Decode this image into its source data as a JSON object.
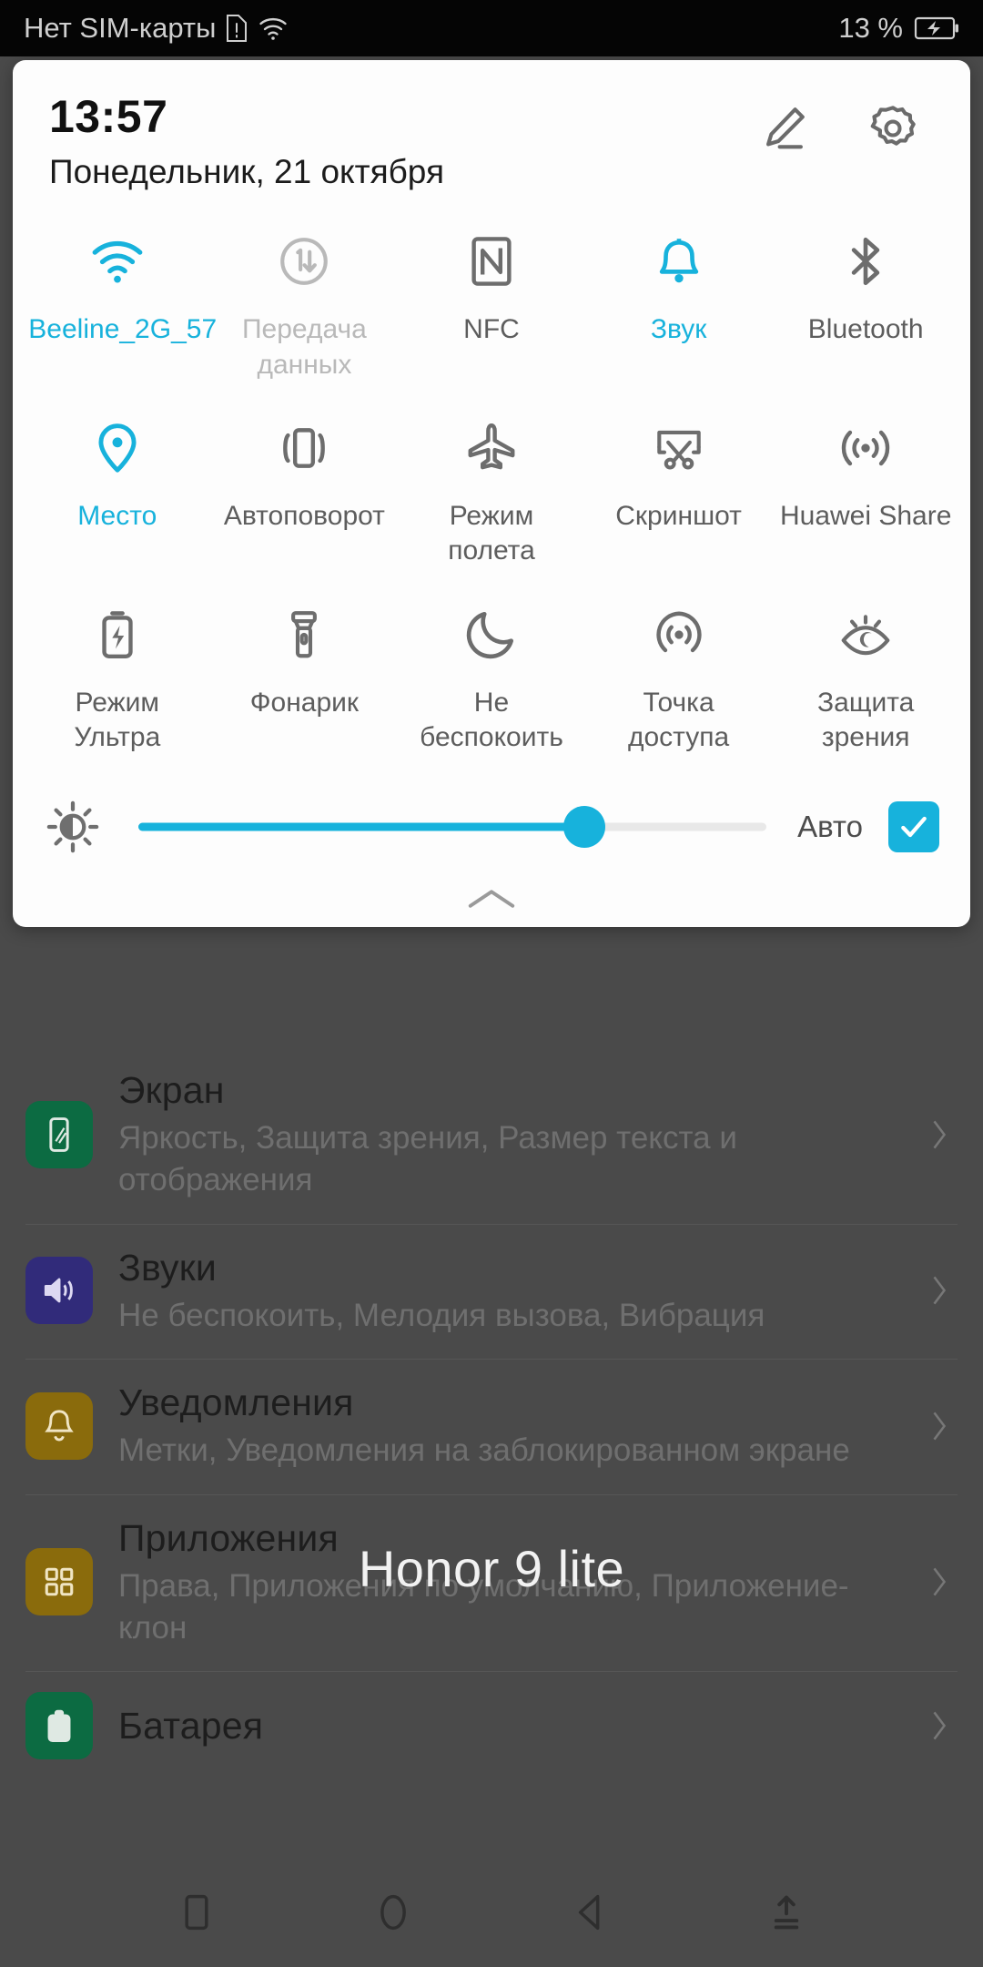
{
  "status_bar": {
    "carrier": "Нет SIM-карты",
    "sim_alert_icon": "sim-card-alert-icon",
    "wifi_icon": "wifi-icon",
    "battery_percent": "13 %",
    "battery_icon": "battery-charging-icon"
  },
  "panel": {
    "time": "13:57",
    "date": "Понедельник, 21 октября",
    "edit_icon": "pencil-edit-icon",
    "settings_icon": "gear-icon",
    "collapse_handle_icon": "chevron-up-icon",
    "accent_color": "#17b2dc",
    "inactive_color": "#6d6d6d",
    "disabled_color": "#b9b9b9",
    "tiles": [
      {
        "label": "Beeline_2G_57",
        "icon": "wifi-icon",
        "state": "on"
      },
      {
        "label": "Передача данных",
        "icon": "mobile-data-icon",
        "state": "disabled"
      },
      {
        "label": "NFC",
        "icon": "nfc-icon",
        "state": "off"
      },
      {
        "label": "Звук",
        "icon": "bell-icon",
        "state": "on"
      },
      {
        "label": "Bluetooth",
        "icon": "bluetooth-icon",
        "state": "off"
      },
      {
        "label": "Место",
        "icon": "location-pin-icon",
        "state": "on"
      },
      {
        "label": "Автоповорот",
        "icon": "auto-rotate-icon",
        "state": "off"
      },
      {
        "label": "Режим полета",
        "icon": "airplane-icon",
        "state": "off"
      },
      {
        "label": "Скриншот",
        "icon": "screenshot-icon",
        "state": "off"
      },
      {
        "label": "Huawei Share",
        "icon": "huawei-share-icon",
        "state": "off"
      },
      {
        "label": "Режим Ультра",
        "icon": "battery-ultra-icon",
        "state": "off"
      },
      {
        "label": "Фонарик",
        "icon": "flashlight-icon",
        "state": "off"
      },
      {
        "label": "Не беспокоить",
        "icon": "moon-icon",
        "state": "off"
      },
      {
        "label": "Точка доступа",
        "icon": "hotspot-icon",
        "state": "off"
      },
      {
        "label": "Защита зрения",
        "icon": "eye-comfort-icon",
        "state": "off"
      }
    ],
    "brightness": {
      "icon": "brightness-sun-icon",
      "value_percent": 71,
      "auto_label": "Авто",
      "auto_checked": true,
      "check_icon": "checkmark-icon"
    }
  },
  "settings_screen": {
    "watermark": "Honor 9 lite",
    "rows": [
      {
        "title": "Экран",
        "subtitle": "Яркость, Защита зрения, Размер текста и отображения",
        "icon": "display-icon",
        "icon_color": "#0c6b42",
        "chevron": "chevron-right-icon"
      },
      {
        "title": "Звуки",
        "subtitle": "Не беспокоить, Мелодия вызова, Вибрация",
        "icon": "speaker-icon",
        "icon_color": "#312b7a",
        "chevron": "chevron-right-icon"
      },
      {
        "title": "Уведомления",
        "subtitle": "Метки, Уведомления на заблокированном экране",
        "icon": "bell-icon",
        "icon_color": "#8a6b0c",
        "chevron": "chevron-right-icon"
      },
      {
        "title": "Приложения",
        "subtitle": "Права, Приложения по умолчанию, Приложение-клон",
        "icon": "apps-grid-icon",
        "icon_color": "#8a6b0c",
        "chevron": "chevron-right-icon"
      },
      {
        "title": "Батарея",
        "subtitle": "",
        "icon": "battery-icon",
        "icon_color": "#0c6b42",
        "chevron": "chevron-right-icon"
      }
    ]
  },
  "nav_bar": {
    "buttons": [
      {
        "name": "recents-button",
        "icon": "square-icon"
      },
      {
        "name": "home-button",
        "icon": "circle-icon"
      },
      {
        "name": "back-button",
        "icon": "triangle-left-icon"
      },
      {
        "name": "hide-navbar-button",
        "icon": "arrow-up-lines-icon"
      }
    ]
  }
}
